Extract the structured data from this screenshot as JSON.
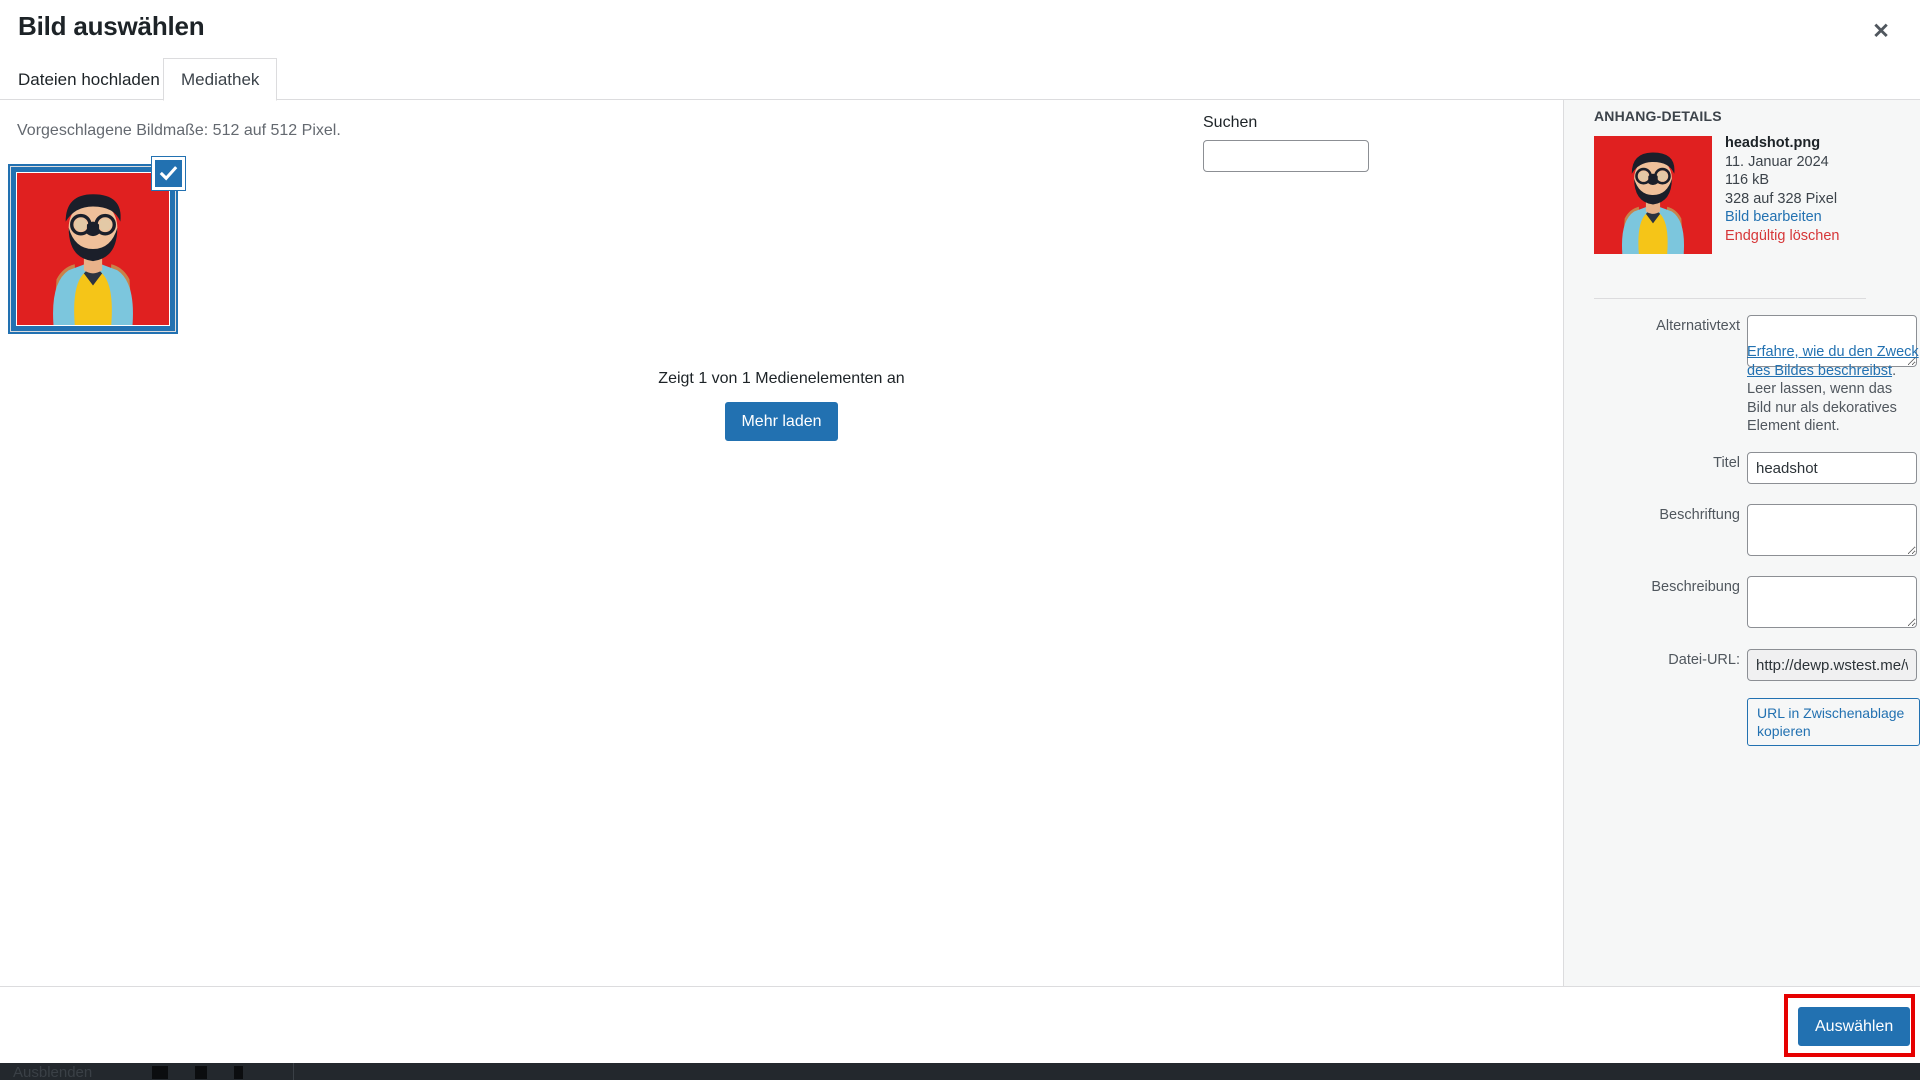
{
  "modal": {
    "title": "Bild auswählen",
    "close_label": "✕",
    "close_icon": "close-icon"
  },
  "tabs": [
    {
      "label": "Dateien hochladen",
      "active": false
    },
    {
      "label": "Mediathek",
      "active": true
    }
  ],
  "library": {
    "suggested_dimensions": "Vorgeschlagene Bildmaße: 512 auf 512 Pixel.",
    "count_text": "Zeigt 1 von 1 Medienelementen an",
    "load_more_label": "Mehr laden",
    "attachment_selected": true,
    "check_icon": "check-icon"
  },
  "search": {
    "label": "Suchen",
    "value": "",
    "placeholder": ""
  },
  "sidebar": {
    "heading": "ANHANG-DETAILS",
    "attachment": {
      "filename": "headshot.png",
      "date": "11. Januar 2024",
      "filesize": "116 kB",
      "dimensions": "328 auf 328 Pixel",
      "edit_link": "Bild bearbeiten",
      "delete_link": "Endgültig löschen"
    },
    "fields": {
      "alt_text": {
        "label": "Alternativtext",
        "value": ""
      },
      "alt_help_link": "Erfahre, wie du den Zweck des Bildes beschreibst",
      "alt_help_rest": ". Leer lassen, wenn das Bild nur als dekoratives Element dient.",
      "title": {
        "label": "Titel",
        "value": "headshot"
      },
      "caption": {
        "label": "Beschriftung",
        "value": ""
      },
      "description": {
        "label": "Beschreibung",
        "value": ""
      },
      "file_url": {
        "label": "Datei-URL:",
        "value": "http://dewp.wstest.me/wp-"
      }
    },
    "copy_url_label": "URL in Zwischenablage kopieren"
  },
  "footer": {
    "select_label": "Auswählen"
  },
  "bottom_bar": {
    "hide_label": "Ausblenden",
    "desktop_icon": "desktop-icon",
    "tablet_icon": "tablet-icon",
    "mobile_icon": "mobile-icon"
  },
  "colors": {
    "accent": "#2271b1",
    "danger": "#d63638",
    "highlight": "#e60000",
    "sidebar_bg": "#f6f7f7",
    "border": "#dcdcde"
  }
}
